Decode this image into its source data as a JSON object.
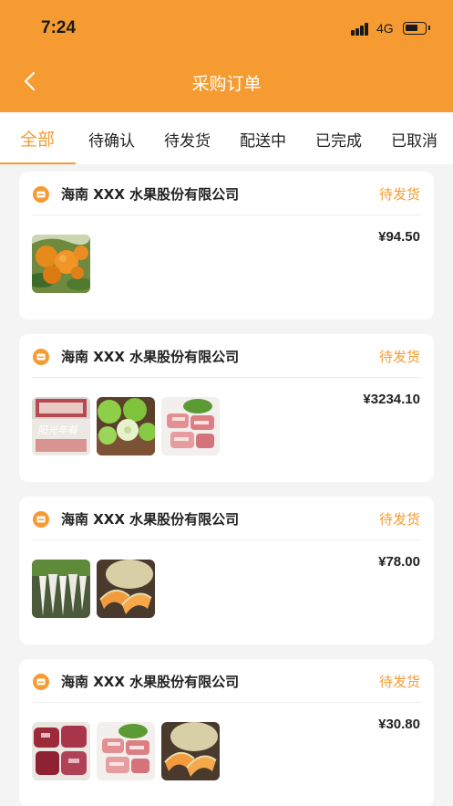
{
  "status_bar": {
    "time": "7:24",
    "network": "4G"
  },
  "nav": {
    "title": "采购订单"
  },
  "tabs": [
    {
      "label": "全部",
      "active": true
    },
    {
      "label": "待确认",
      "active": false
    },
    {
      "label": "待发货",
      "active": false
    },
    {
      "label": "配送中",
      "active": false
    },
    {
      "label": "已完成",
      "active": false
    },
    {
      "label": "已取消",
      "active": false
    }
  ],
  "colors": {
    "accent": "#f59b32",
    "background": "#f4f4f4",
    "card": "#ffffff"
  },
  "orders": [
    {
      "store": "海南 XXX 水果股份有限公司",
      "status": "待发货",
      "price": "¥94.50",
      "items": [
        {
          "icon": "orange-fruit-image"
        }
      ]
    },
    {
      "store": "海南 XXX 水果股份有限公司",
      "status": "待发货",
      "price": "¥3234.10",
      "items": [
        {
          "icon": "food-package-image"
        },
        {
          "icon": "green-apple-image"
        },
        {
          "icon": "pork-ribs-image"
        }
      ]
    },
    {
      "store": "海南 XXX 水果股份有限公司",
      "status": "待发货",
      "price": "¥78.00",
      "items": [
        {
          "icon": "white-radish-image"
        },
        {
          "icon": "cantaloupe-image"
        }
      ]
    },
    {
      "store": "海南 XXX 水果股份有限公司",
      "status": "待发货",
      "price": "¥30.80",
      "items": [
        {
          "icon": "lamb-meat-image"
        },
        {
          "icon": "pork-ribs-image"
        },
        {
          "icon": "cantaloupe-image"
        }
      ]
    }
  ]
}
